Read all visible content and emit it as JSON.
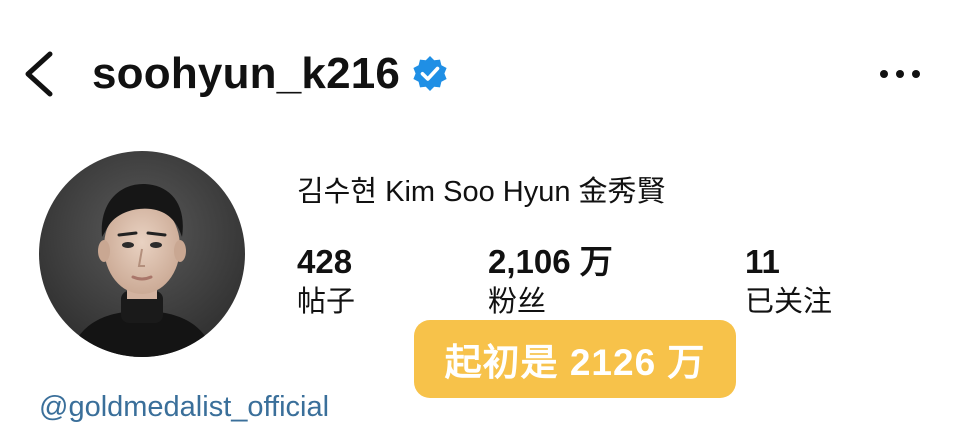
{
  "header": {
    "back_icon": "chevron-left-icon",
    "username": "soohyun_k216",
    "verified_icon": "verified-badge-icon",
    "more_icon": "more-horizontal-icon"
  },
  "profile": {
    "full_name": "김수현 Kim Soo Hyun 金秀賢",
    "linked_account": "@goldmedalist_official"
  },
  "stats": {
    "posts": {
      "value": "428",
      "label": "帖子"
    },
    "followers": {
      "value": "2,106 万",
      "label": "粉丝"
    },
    "following": {
      "value": "11",
      "label": "已关注"
    }
  },
  "annotation": {
    "text": "起初是 2126 万"
  },
  "colors": {
    "verified_blue": "#1f8fe5",
    "annotation_bg": "#f7c24a",
    "link": "#3a6f9a"
  }
}
